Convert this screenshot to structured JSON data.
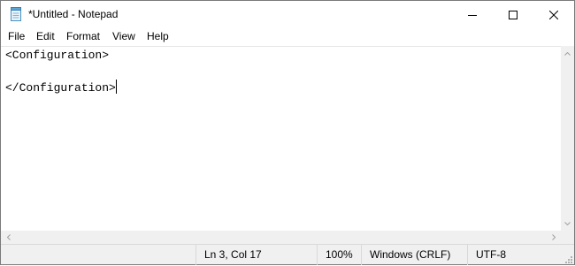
{
  "window": {
    "title": "*Untitled - Notepad",
    "icon": "notepad-icon",
    "controls": {
      "minimize_icon": "minimize-icon",
      "maximize_icon": "maximize-icon",
      "close_icon": "close-icon"
    }
  },
  "menu": {
    "items": [
      "File",
      "Edit",
      "Format",
      "View",
      "Help"
    ]
  },
  "editor": {
    "lines": [
      "<Configuration>",
      "",
      "</Configuration>"
    ]
  },
  "status": {
    "position": "Ln 3, Col 17",
    "zoom": "100%",
    "line_ending": "Windows (CRLF)",
    "encoding": "UTF-8"
  },
  "colors": {
    "chrome_bg": "#f0f0f0",
    "editor_bg": "#ffffff"
  }
}
